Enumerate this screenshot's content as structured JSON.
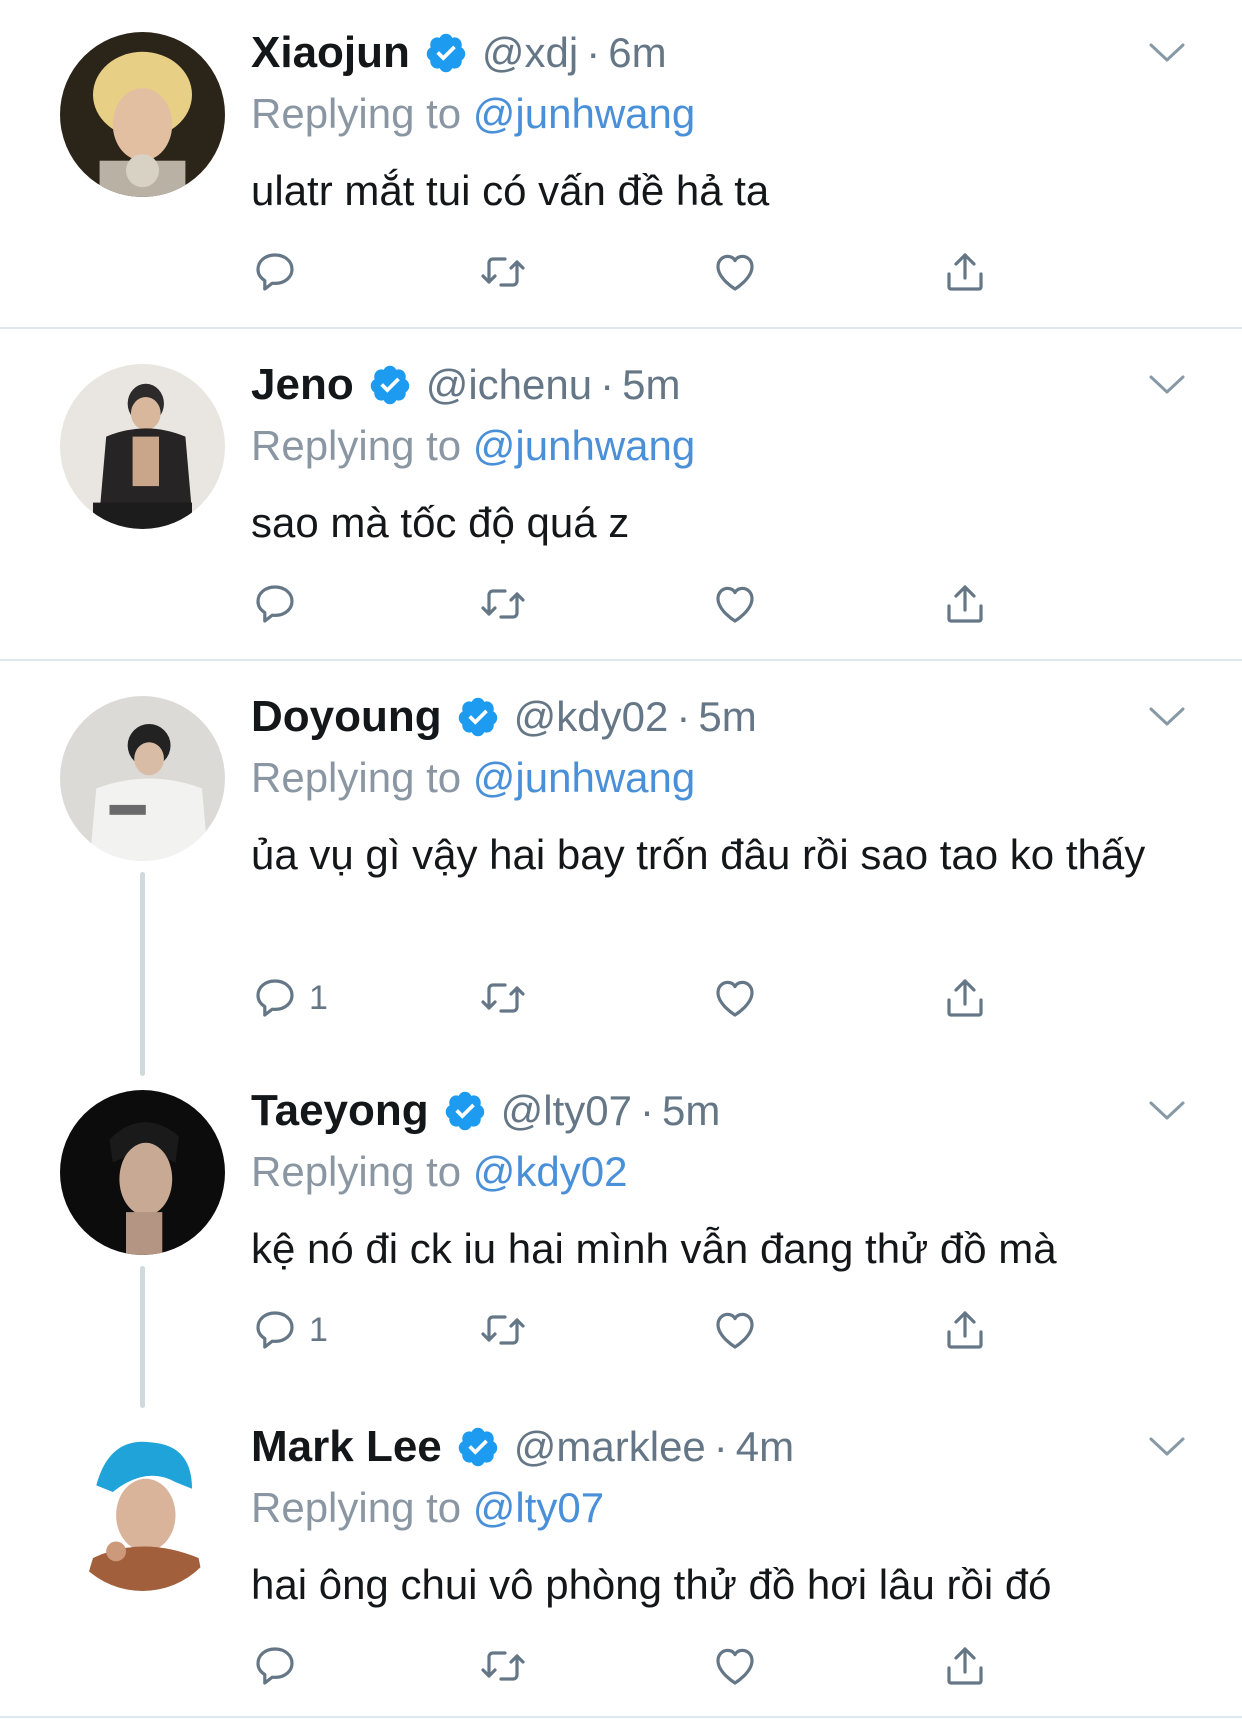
{
  "colors": {
    "accent": "#4a90d9",
    "verified": "#1d9bf0",
    "muted": "#657786",
    "icon": "#657786"
  },
  "tweets": [
    {
      "name": "Xiaojun",
      "handle": "@xdj",
      "dot": "·",
      "time": "6m",
      "replying_prefix": "Replying to",
      "replying_to": "@junhwang",
      "text": "ulatr mắt tui có vấn đề hả ta",
      "reply_count": ""
    },
    {
      "name": "Jeno",
      "handle": "@ichenu",
      "dot": "·",
      "time": "5m",
      "replying_prefix": "Replying to",
      "replying_to": "@junhwang",
      "text": "sao mà tốc độ quá z",
      "reply_count": ""
    },
    {
      "name": "Doyoung",
      "handle": "@kdy02",
      "dot": "·",
      "time": "5m",
      "replying_prefix": "Replying to",
      "replying_to": "@junhwang",
      "text": "ủa vụ gì vậy hai bay trốn đâu rồi sao tao ko thấy",
      "reply_count": "1"
    },
    {
      "name": "Taeyong",
      "handle": "@lty07",
      "dot": "·",
      "time": "5m",
      "replying_prefix": "Replying to",
      "replying_to": "@kdy02",
      "text": "kệ nó đi ck iu hai mình vẫn đang thử đồ mà",
      "reply_count": "1"
    },
    {
      "name": "Mark Lee",
      "handle": "@marklee",
      "dot": "·",
      "time": "4m",
      "replying_prefix": "Replying to",
      "replying_to": "@lty07",
      "text": "hai ông chui vô phòng thử đồ hơi lâu rồi đó",
      "reply_count": ""
    }
  ],
  "icons": [
    "verified-badge-icon",
    "chevron-down-icon",
    "reply-icon",
    "retweet-icon",
    "like-icon",
    "share-icon"
  ]
}
